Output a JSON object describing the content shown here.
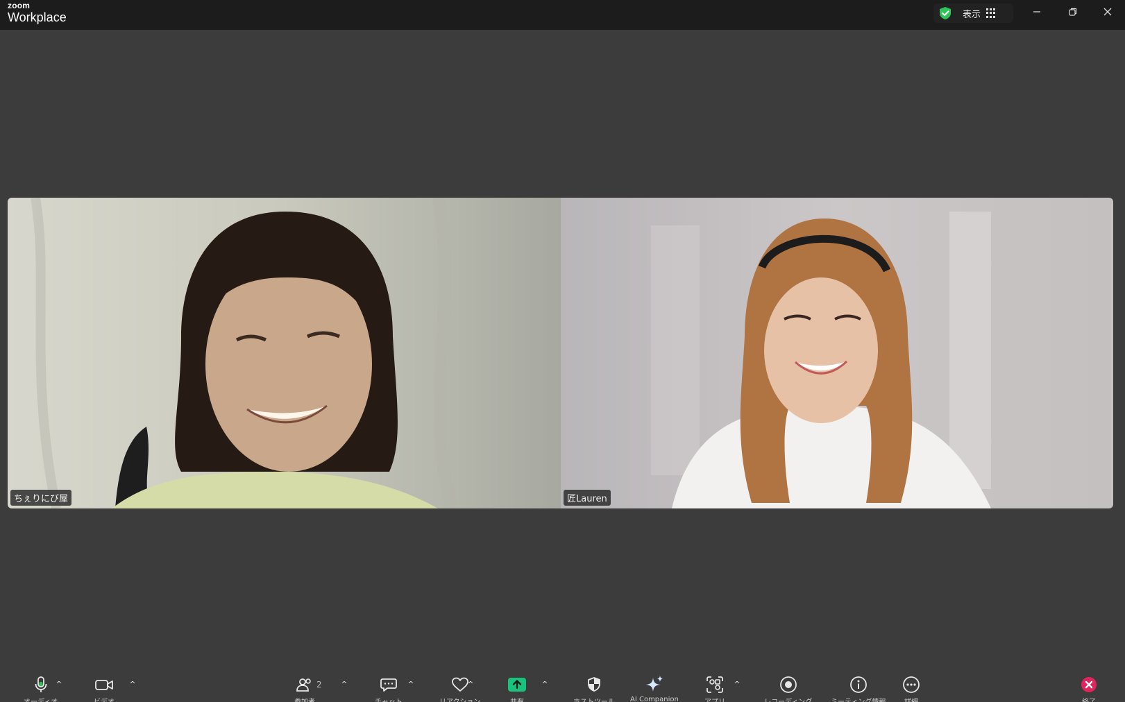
{
  "app": {
    "logo_small": "zoom",
    "logo_big": "Workplace",
    "view_label": "表示"
  },
  "participants": [
    {
      "name": "ちぇりにび屋"
    },
    {
      "name": "匠Lauren"
    }
  ],
  "toolbar": {
    "audio_label": "オーディオ",
    "video_label": "ビデオ",
    "participants_label": "参加者",
    "participants_count": "2",
    "chat_label": "チャット",
    "react_label": "リアクション",
    "share_label": "共有",
    "host_tools_label": "ホストツール",
    "ai_label": "AI Companion",
    "apps_label": "アプリ",
    "record_label": "レコーディング",
    "info_label": "ミーティング情報",
    "more_label": "詳細",
    "end_label": "終了"
  },
  "colors": {
    "secure_green": "#2fc35a",
    "share_green": "#19c37d",
    "end_red": "#e0245e"
  }
}
